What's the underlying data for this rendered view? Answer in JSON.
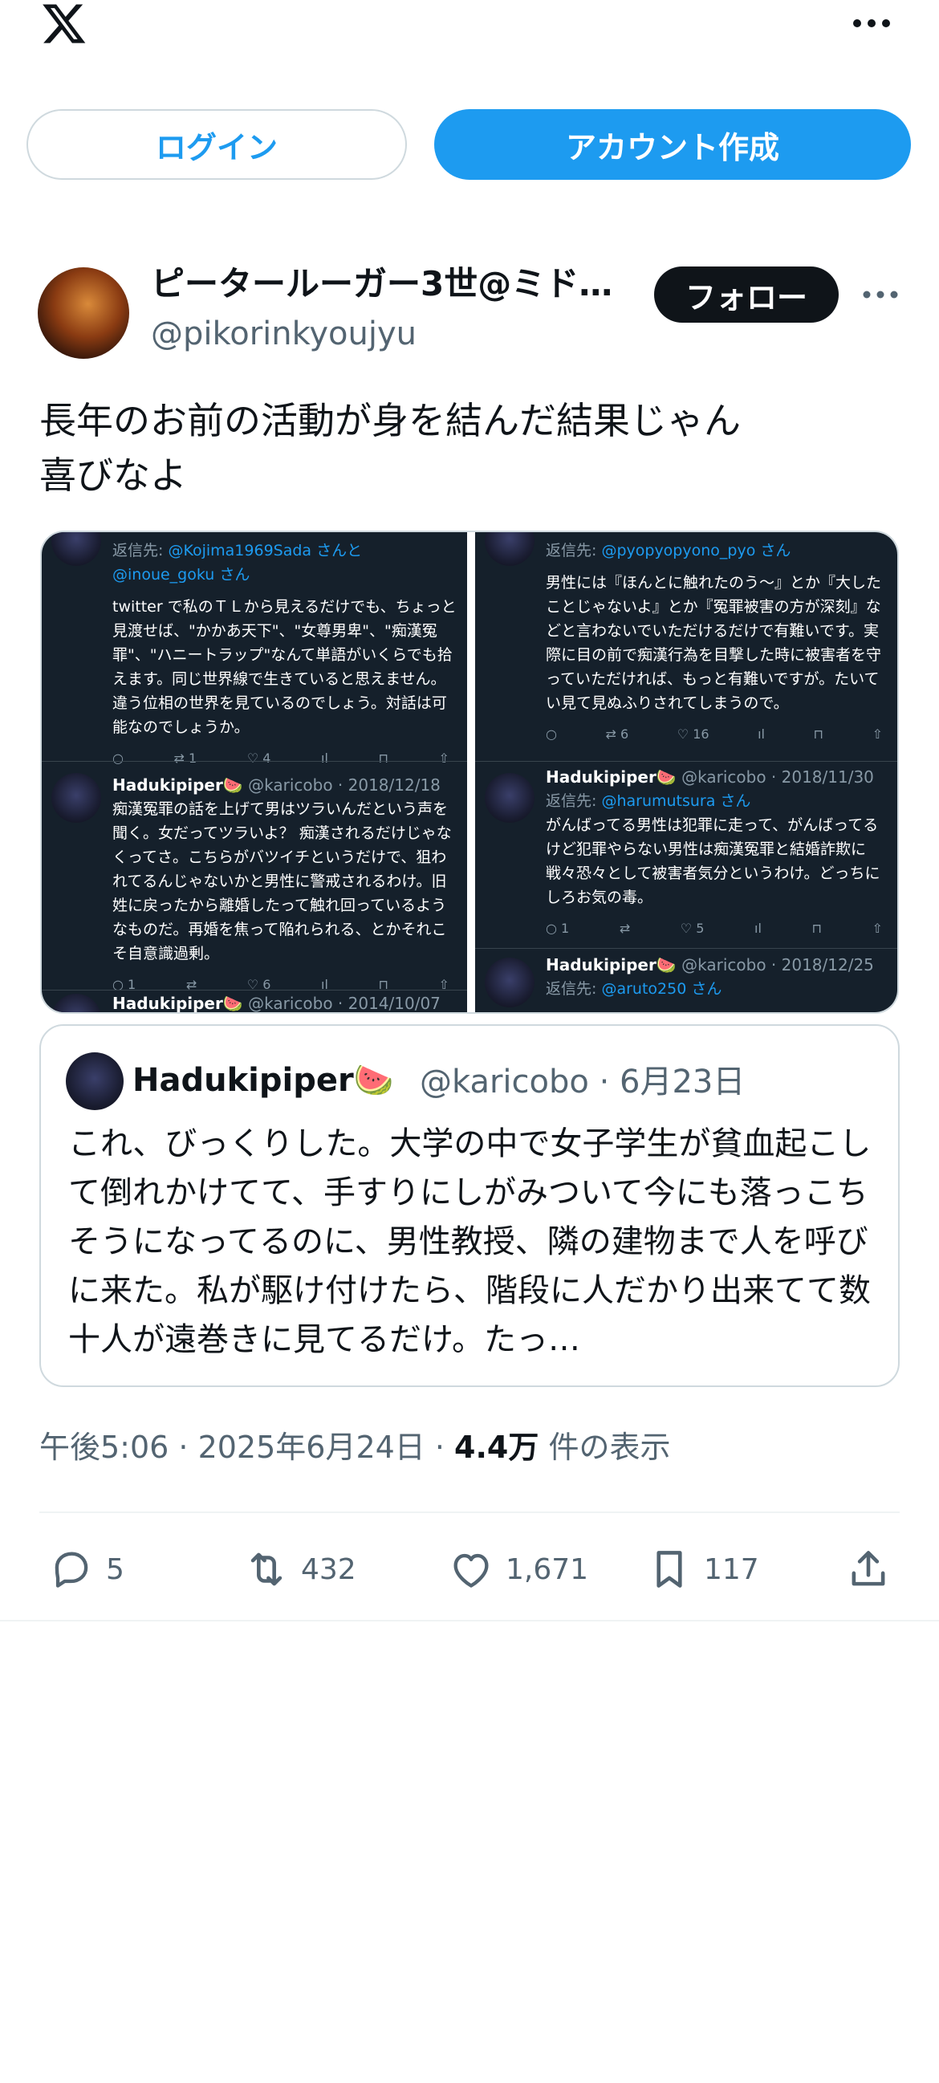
{
  "header": {
    "logo_icon": "x-logo-icon",
    "more_icon": "more-horizontal-icon",
    "login_label": "ログイン",
    "signup_label": "アカウント作成"
  },
  "tweet": {
    "author": {
      "display_name": "ピータールーガー3世@ミド…",
      "handle": "@pikorinkyoujyu",
      "follow_label": "フォロー"
    },
    "text": "長年のお前の活動が身を結んだ結果じゃん\n喜びなよ",
    "media": {
      "left": [
        {
          "reply_to_label": "返信先:",
          "reply_to": "@Kojima1969Sada さんと\n@inoue_goku さん",
          "body": "twitter で私のＴＬから見えるだけでも、ちょっと見渡せば、\"かかあ天下\"、\"女尊男卑\"、\"痴漢冤罪\"、\"ハニートラップ\"なんて単語がいくらでも拾えます。同じ世界線で生きていると思えません。違う位相の世界を見ているのでしょう。対話は可能なのでしょうか。",
          "retweets": "1",
          "likes": "4"
        },
        {
          "name": "Hadukipiper🍉",
          "handle_date": "@karicobo · 2018/12/18",
          "body": "痴漢冤罪の話を上げて男はツラいんだという声を聞く。女だってツラいよ？ 痴漢されるだけじゃなくってさ。こちらがバツイチというだけで、狙われてるんじゃないかと男性に警戒されるわけ。旧姓に戻ったから離婚したって触れ回っているようなものだ。再婚を焦って陥れられる、とかそれこそ自意識過剰。",
          "replies": "1",
          "likes": "6"
        },
        {
          "name": "Hadukipiper🍉",
          "handle_date": "@karicobo · 2014/10/07"
        }
      ],
      "right": [
        {
          "reply_to_label": "返信先:",
          "reply_to": "@pyopyopyono_pyo さん",
          "body": "男性には『ほんとに触れたのう〜』とか『大したことじゃないよ』とか『冤罪被害の方が深刻』などと言わないでいただけるだけで有難いです。実際に目の前で痴漢行為を目撃した時に被害者を守っていただければ、もっと有難いですが。たいてい見て見ぬふりされてしまうので。",
          "retweets": "6",
          "likes": "16"
        },
        {
          "name": "Hadukipiper🍉",
          "handle_date": "@karicobo · 2018/11/30",
          "reply_to_label": "返信先:",
          "reply_to": "@harumutsura さん",
          "body": "がんばってる男性は犯罪に走って、がんばってるけど犯罪やらない男性は痴漢冤罪と結婚詐欺に戦々恐々として被害者気分というわけ。どっちにしろお気の毒。",
          "replies": "1",
          "likes": "5"
        },
        {
          "name": "Hadukipiper🍉",
          "handle_date": "@karicobo · 2018/12/25",
          "reply_to_label": "返信先:",
          "reply_to": "@aruto250 さん"
        }
      ]
    },
    "quote": {
      "name": "Hadukipiper🍉",
      "handle_date": "@karicobo · 6月23日",
      "text": "これ、びっくりした。大学の中で女子学生が貧血起こして倒れかけてて、手すりにしがみついて今にも落っこちそうになってるのに、男性教授、隣の建物まで人を呼びに来た。私が駆け付けたら、階段に人だかり出来てて数十人が遠巻きに見てるだけ。たっ…"
    },
    "meta": {
      "time_date": "午後5:06 · 2025年6月24日 · ",
      "views_count": "4.4万",
      "views_label": "件の表示"
    },
    "actions": {
      "replies": "5",
      "retweets": "432",
      "likes": "1,671",
      "bookmarks": "117"
    }
  }
}
